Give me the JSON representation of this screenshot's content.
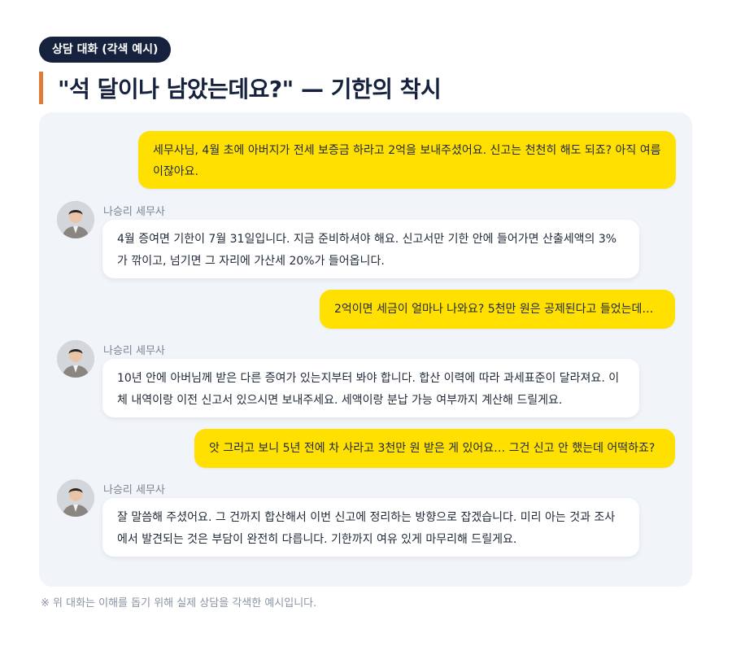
{
  "header": {
    "badge": "상담 대화 (각색 예시)",
    "title": "\"석 달이나 남았는데요?\" — 기한의 착시"
  },
  "colors": {
    "user_bubble": "#ffe000",
    "agent_bubble": "#ffffff",
    "panel_bg": "#f1f4f9",
    "badge_bg": "#16213e",
    "accent_bar": "#e07b39"
  },
  "messages": [
    {
      "role": "user",
      "text": "세무사님, 4월 초에 아버지가 전세 보증금 하라고 2억을 보내주셨어요. 신고는 천천히 해도 되죠? 아직 여름이잖아요."
    },
    {
      "role": "agent",
      "sender": "나승리 세무사",
      "avatar_icon": "advisor-avatar-icon",
      "text": "4월 증여면 기한이 7월 31일입니다. 지금 준비하셔야 해요. 신고서만 기한 안에 들어가면 산출세액의 3%가 깎이고, 넘기면 그 자리에 가산세 20%가 들어옵니다."
    },
    {
      "role": "user",
      "text": "2억이면 세금이 얼마나 나와요? 5천만 원은 공제된다고 들었는데…"
    },
    {
      "role": "agent",
      "sender": "나승리 세무사",
      "avatar_icon": "advisor-avatar-icon",
      "text": "10년 안에 아버님께 받은 다른 증여가 있는지부터 봐야 합니다. 합산 이력에 따라 과세표준이 달라져요. 이체 내역이랑 이전 신고서 있으시면 보내주세요. 세액이랑 분납 가능 여부까지 계산해 드릴게요."
    },
    {
      "role": "user",
      "text": "앗 그러고 보니 5년 전에 차 사라고 3천만 원 받은 게 있어요… 그건 신고 안 했는데 어떡하죠?"
    },
    {
      "role": "agent",
      "sender": "나승리 세무사",
      "avatar_icon": "advisor-avatar-icon",
      "text": "잘 말씀해 주셨어요. 그 건까지 합산해서 이번 신고에 정리하는 방향으로 잡겠습니다. 미리 아는 것과 조사에서 발견되는 것은 부담이 완전히 다릅니다. 기한까지 여유 있게 마무리해 드릴게요."
    }
  ],
  "footnote": "※ 위 대화는 이해를 돕기 위해 실제 상담을 각색한 예시입니다."
}
